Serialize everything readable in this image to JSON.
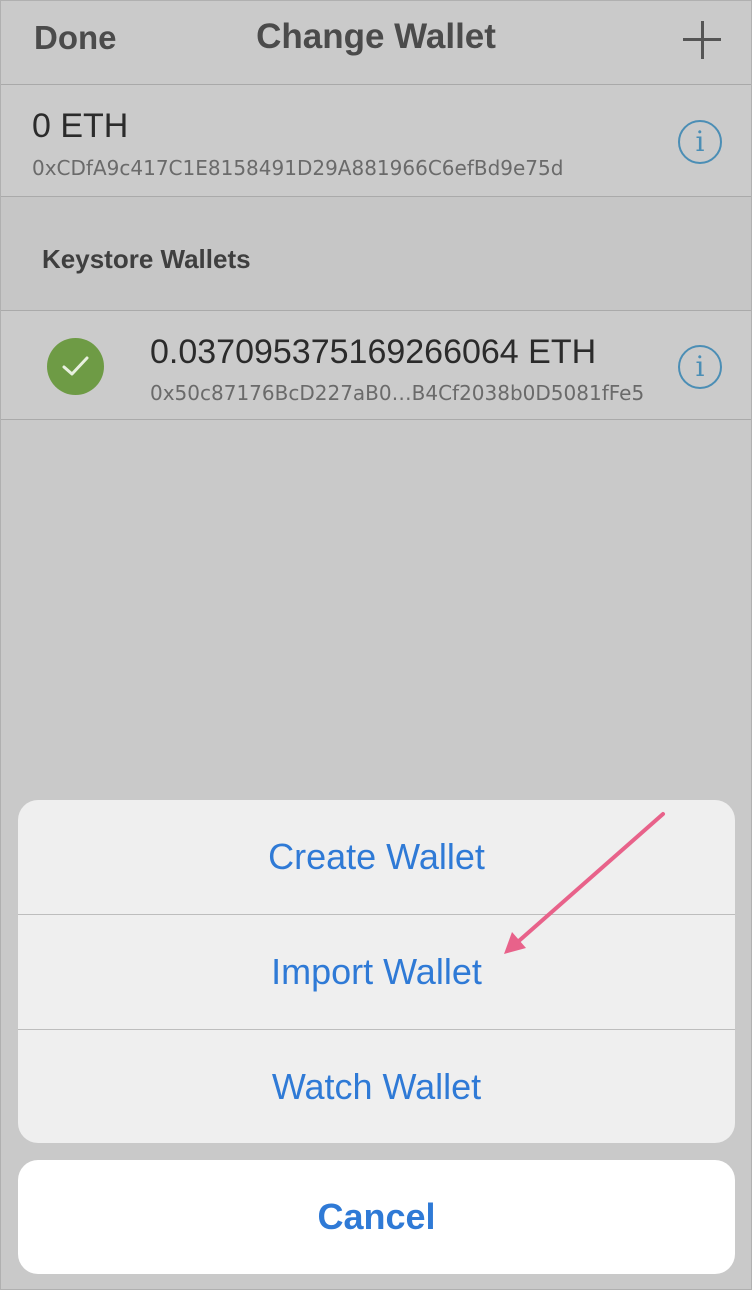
{
  "nav": {
    "done_label": "Done",
    "title": "Change Wallet",
    "add_icon": "plus-icon"
  },
  "current_wallet": {
    "balance": "0 ETH",
    "address": "0xCDfA9c417C1E8158491D29A881966C6efBd9e75d",
    "info_icon": "i"
  },
  "section": {
    "label": "Keystore Wallets"
  },
  "keystore_wallet": {
    "balance": "0.037095375169266064 ETH",
    "address": "0x50c87176BcD227aB0…B4Cf2038b0D5081fFe5",
    "info_icon": "i",
    "selected": true
  },
  "action_sheet": {
    "items": [
      {
        "label": "Create Wallet"
      },
      {
        "label": "Import Wallet"
      },
      {
        "label": "Watch Wallet"
      }
    ],
    "cancel_label": "Cancel"
  },
  "colors": {
    "accent": "#2f7ad6",
    "check": "#6e9b45",
    "info": "#4b8eb5",
    "annotation_arrow": "#e8628a"
  }
}
